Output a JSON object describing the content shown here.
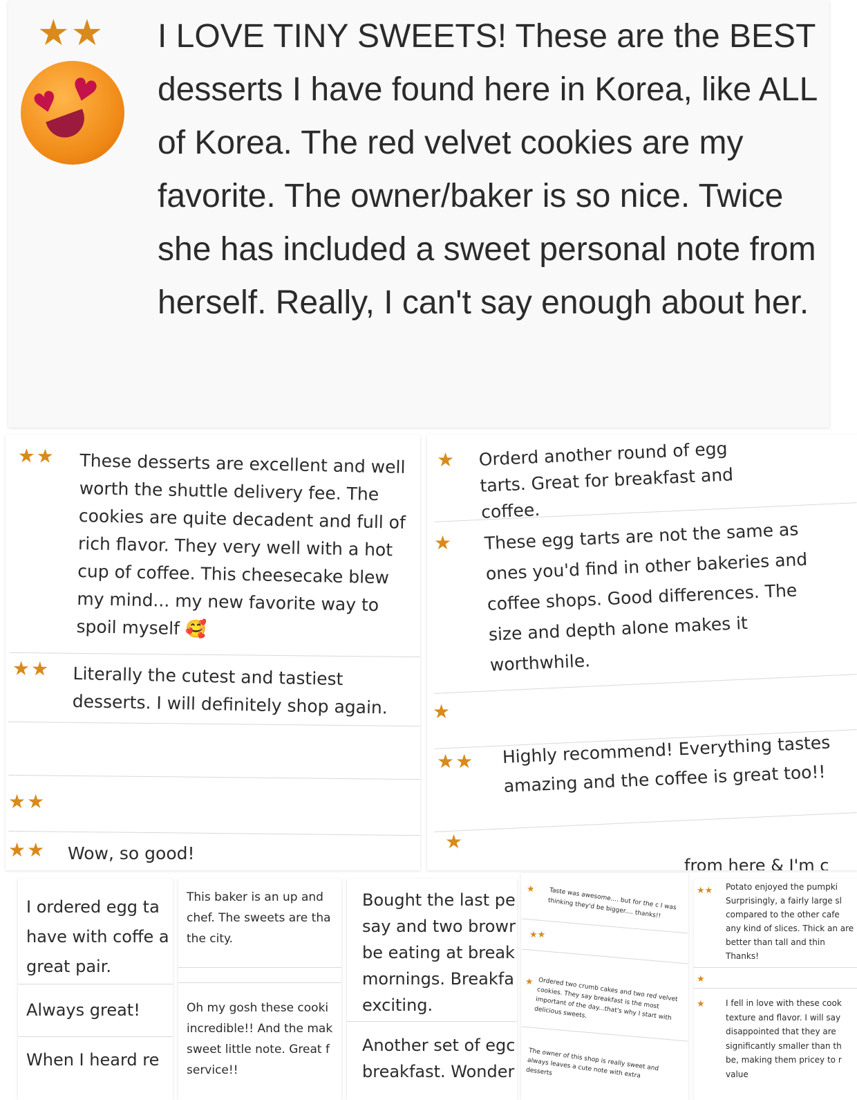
{
  "colors": {
    "star": "#d98a1b",
    "text": "#2b2b2b",
    "divider": "#d9d9d9"
  },
  "top_review": {
    "stars": "★★",
    "emoji_icon": "heart-eyes-emoji",
    "text": "I LOVE TINY SWEETS! These are the BEST desserts I have found here in Korea, like ALL of Korea. The red velvet cookies are my favorite. The owner/baker is so nice. Twice she has included a sweet personal note from herself. Really, I can't say enough about her."
  },
  "left_column": [
    {
      "stars": "★★",
      "text": "These desserts are excellent and well worth the shuttle delivery fee. The cookies are quite decadent and full of rich flavor. They very well with a hot cup of coffee. This cheesecake blew my mind... my new favorite way to spoil myself 🥰"
    },
    {
      "stars": "★★",
      "text": "Literally the cutest and tastiest desserts. I will definitely shop again."
    },
    {
      "stars": "★★",
      "text": ""
    },
    {
      "stars": "★★",
      "text": "Wow, so good!"
    }
  ],
  "right_column": [
    {
      "stars": "★",
      "text": "Orderd another round of egg tarts. Great for breakfast and coffee."
    },
    {
      "stars": "★",
      "text": "These egg tarts are not the same as ones you'd find in other bakeries and coffee shops. Good differences. The size and depth alone makes it worthwhile."
    },
    {
      "stars": "★",
      "text": ""
    },
    {
      "stars": "★★",
      "text": "Highly recommend! Everything tastes amazing and the coffee is great too!!"
    },
    {
      "stars": "★",
      "text": ""
    },
    {
      "stars": "",
      "text": "from here & I'm c"
    }
  ],
  "bottom": {
    "col1": [
      {
        "text": "I ordered egg ta have with coffe a great pair."
      },
      {
        "text": "Always great!"
      },
      {
        "text": "When I heard re"
      }
    ],
    "col2": [
      {
        "text": "This baker is an up and chef. The sweets are tha the city."
      },
      {
        "text": "Oh my gosh these cooki incredible!! And the mak sweet little note. Great f service!!"
      }
    ],
    "col3": [
      {
        "text": "Bought the last pe say and two browr be eating at break mornings. Breakfa exciting."
      },
      {
        "text": "Another set of egc breakfast. Wonder"
      }
    ],
    "col4": [
      {
        "stars": "★",
        "text": "Taste was awesome.... but for the c I was thinking they'd be bigger.... thanks!!"
      },
      {
        "stars": "★★",
        "text": ""
      },
      {
        "stars": "★",
        "text": "Ordered two crumb cakes and two red velvet cookies. They say breakfast is the most important of the day...that's why I start with delicious sweets."
      },
      {
        "stars": "",
        "text": "The owner of this shop is really sweet and always leaves a cute note with extra desserts"
      }
    ],
    "col5": [
      {
        "stars": "★★",
        "text": "Potato enjoyed the pumpki Surprisingly, a fairly large sl compared to the other cafe any kind of slices. Thick an are better than tall and thin Thanks!"
      },
      {
        "stars": "★",
        "text": ""
      },
      {
        "stars": "★",
        "text": "I fell in love with these cook texture and flavor. I will say disappointed that they are significantly smaller than th be, making them pricey to r value"
      }
    ]
  }
}
